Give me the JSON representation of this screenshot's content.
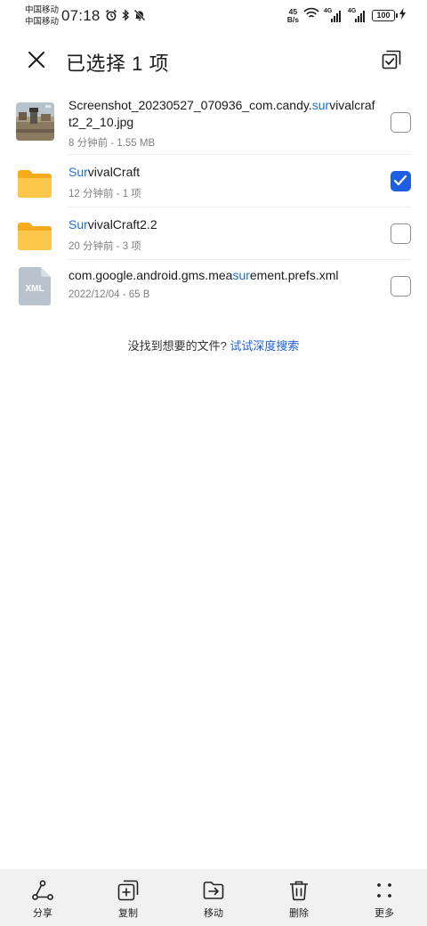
{
  "status_bar": {
    "carrier_1": "中国移动",
    "carrier_2": "中国移动",
    "time": "07:18",
    "net_speed_value": "45",
    "net_speed_unit": "B/s",
    "signal_1_label": "4G",
    "signal_2_label": "4G",
    "battery": "100"
  },
  "header": {
    "title": "已选择 1 项"
  },
  "files": [
    {
      "name_before": "Screenshot_20230527_070936_com.candy.",
      "name_match": "sur",
      "name_after": "vivalcraft2_2_10.jpg",
      "meta": "8 分钟前 - 1.55 MB",
      "type": "image",
      "checked": false
    },
    {
      "name_before": "",
      "name_match": "Sur",
      "name_after": "vivalCraft",
      "meta": "12 分钟前 - 1 项",
      "type": "folder",
      "checked": true
    },
    {
      "name_before": "",
      "name_match": "Sur",
      "name_after": "vivalCraft2.2",
      "meta": "20 分钟前 - 3 项",
      "type": "folder",
      "checked": false
    },
    {
      "name_before": "com.google.android.gms.mea",
      "name_match": "sur",
      "name_after": "ement.prefs.xml",
      "meta": "2022/12/04 - 65 B",
      "type": "xml",
      "file_badge": "XML",
      "checked": false
    }
  ],
  "hint": {
    "text": "没找到想要的文件? ",
    "link": "试试深度搜索"
  },
  "toolbar": {
    "share": "分享",
    "copy": "复制",
    "move": "移动",
    "delete": "删除",
    "more": "更多"
  },
  "colors": {
    "accent": "#1d5fe0",
    "highlight": "#1d6fd8",
    "folder": "#fbc02d",
    "toolbar_bg": "#f1f1f1"
  },
  "icons": {
    "close": "close-icon",
    "select_all": "select-all-icon",
    "share": "share-icon",
    "copy": "copy-icon",
    "move": "move-icon",
    "delete": "trash-icon",
    "more": "more-dots-icon"
  }
}
